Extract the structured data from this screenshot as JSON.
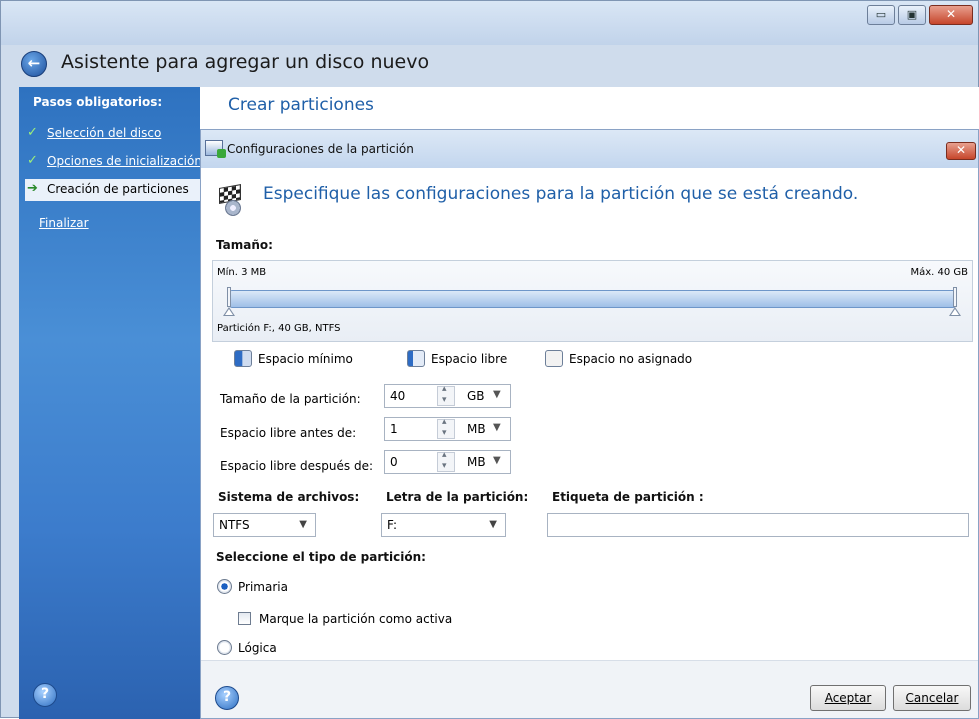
{
  "window": {
    "title": "Asistente para agregar un disco nuevo",
    "controls": {
      "minimize": "▭",
      "maximize": "▣",
      "close": "✕"
    }
  },
  "sidebar": {
    "heading": "Pasos obligatorios:",
    "steps": [
      {
        "label": "Selección del disco",
        "state": "done"
      },
      {
        "label": "Opciones de inicialización",
        "state": "done"
      },
      {
        "label": "Creación de particiones",
        "state": "current"
      },
      {
        "label": "Finalizar",
        "state": "pending"
      }
    ]
  },
  "content": {
    "section_title": "Crear particiones"
  },
  "dialog": {
    "title": "Configuraciones de la partición",
    "headline": "Especifique las configuraciones para la partición que se está creando.",
    "size": {
      "label": "Tamaño:",
      "min_label": "Mín. 3 MB",
      "max_label": "Máx. 40 GB",
      "partition_caption": "Partición F:, 40 GB, NTFS"
    },
    "legend": {
      "min_space": "Espacio mínimo",
      "free_space": "Espacio libre",
      "unallocated": "Espacio no asignado"
    },
    "fields": {
      "partition_size": {
        "label": "Tamaño de la partición:",
        "value": "40",
        "unit": "GB"
      },
      "free_before": {
        "label": "Espacio libre antes de:",
        "value": "1",
        "unit": "MB"
      },
      "free_after": {
        "label": "Espacio libre después de:",
        "value": "0",
        "unit": "MB"
      }
    },
    "filesystem": {
      "label": "Sistema de archivos:",
      "value": "NTFS"
    },
    "letter": {
      "label": "Letra de la partición:",
      "value": "F:"
    },
    "volume_label": {
      "label": "Etiqueta de partición :",
      "value": ""
    },
    "partition_type": {
      "label": "Seleccione el tipo de partición:",
      "primary": "Primaria",
      "mark_active": "Marque la partición como activa",
      "logical": "Lógica",
      "selected": "Primaria"
    },
    "buttons": {
      "ok": "Aceptar",
      "cancel": "Cancelar"
    }
  },
  "icons": {
    "help": "?",
    "back": "←",
    "check": "✓",
    "arrow": "➔",
    "dropdown": "▼",
    "close": "✕"
  }
}
